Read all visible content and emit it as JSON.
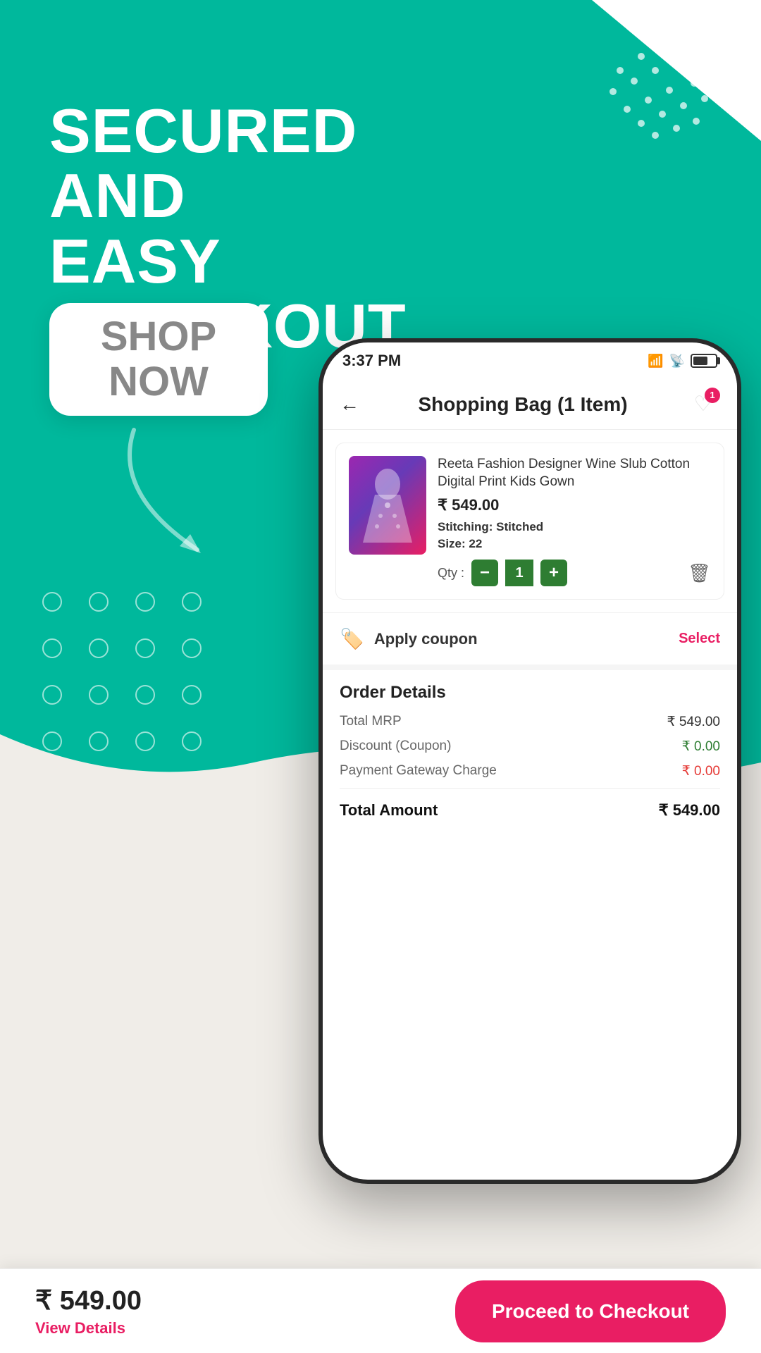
{
  "hero": {
    "headline_line1": "SECURED AND",
    "headline_line2": "EASY CHECKOUT",
    "shop_now": "SHOP\nNOW"
  },
  "phone": {
    "status_bar": {
      "time": "3:37 PM",
      "battery": "50"
    },
    "header": {
      "title": "Shopping Bag (1 Item)",
      "back_label": "←",
      "wishlist_badge": "1"
    },
    "cart_item": {
      "name": "Reeta Fashion Designer Wine Slub Cotton Digital Print Kids Gown",
      "price": "₹ 549.00",
      "stitching_label": "Stitching:",
      "stitching_value": "Stitched",
      "size_label": "Size:",
      "size_value": "22",
      "qty_label": "Qty :",
      "qty_value": "1",
      "qty_minus": "−",
      "qty_plus": "+"
    },
    "coupon": {
      "label": "Apply coupon",
      "action": "Select"
    },
    "order_details": {
      "title": "Order Details",
      "rows": [
        {
          "label": "Total MRP",
          "value": "₹ 549.00",
          "type": "normal"
        },
        {
          "label": "Discount (Coupon)",
          "value": "₹ 0.00",
          "type": "green"
        },
        {
          "label": "Payment Gateway Charge",
          "value": "₹ 0.00",
          "type": "red"
        }
      ],
      "total_label": "Total Amount",
      "total_value": "₹ 549.00"
    }
  },
  "bottom_bar": {
    "price": "₹ 549.00",
    "view_details": "View Details",
    "checkout_btn": "Proceed to Checkout"
  }
}
